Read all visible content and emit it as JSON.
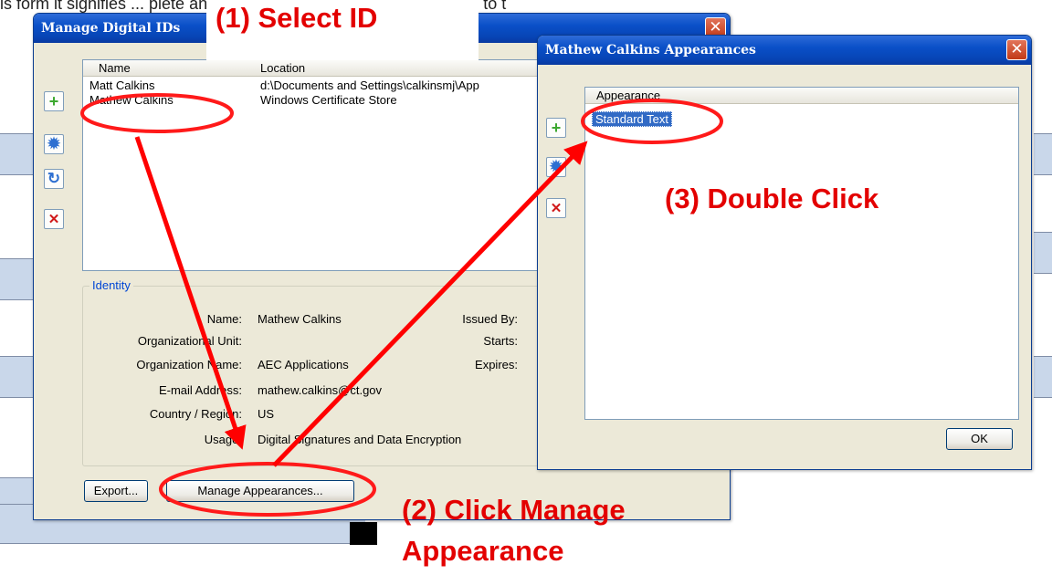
{
  "background_doc": {
    "text_line": "is form it signifies ... plete and has had its built information applied to t"
  },
  "manage_ids_dialog": {
    "title": "Manage Digital IDs",
    "columns": [
      "Name",
      "Location"
    ],
    "rows": [
      {
        "name": "Matt Calkins",
        "location": "d:\\Documents and Settings\\calkinsmj\\App"
      },
      {
        "name": "Mathew Calkins",
        "location": "Windows Certificate Store"
      }
    ],
    "identity": {
      "legend": "Identity",
      "labels": {
        "name": "Name:",
        "org_unit": "Organizational Unit:",
        "org_name": "Organization Name:",
        "email": "E-mail Address:",
        "country": "Country / Region:",
        "usage": "Usage:",
        "issued_by": "Issued By:",
        "starts": "Starts:",
        "expires": "Expires:"
      },
      "values": {
        "name": "Mathew Calkins",
        "org_unit": "",
        "org_name": "AEC Applications",
        "email": "mathew.calkins@ct.gov",
        "country": "US",
        "usage": "Digital Signatures and Data Encryption"
      }
    },
    "buttons": {
      "export": "Export...",
      "manage_appearances": "Manage Appearances..."
    }
  },
  "appearances_dialog": {
    "title": "Mathew Calkins Appearances",
    "column": "Appearance",
    "items": [
      "Standard Text"
    ],
    "ok": "OK"
  },
  "callouts": {
    "step1": "(1) Select ID",
    "step2_line1": "(2) Click Manage",
    "step2_line2": "Appearance",
    "step3": "(3) Double Click"
  },
  "colors": {
    "callout_red": "#e30000",
    "titlebar_blue": "#0a50c8",
    "selection_blue": "#316ac5"
  }
}
